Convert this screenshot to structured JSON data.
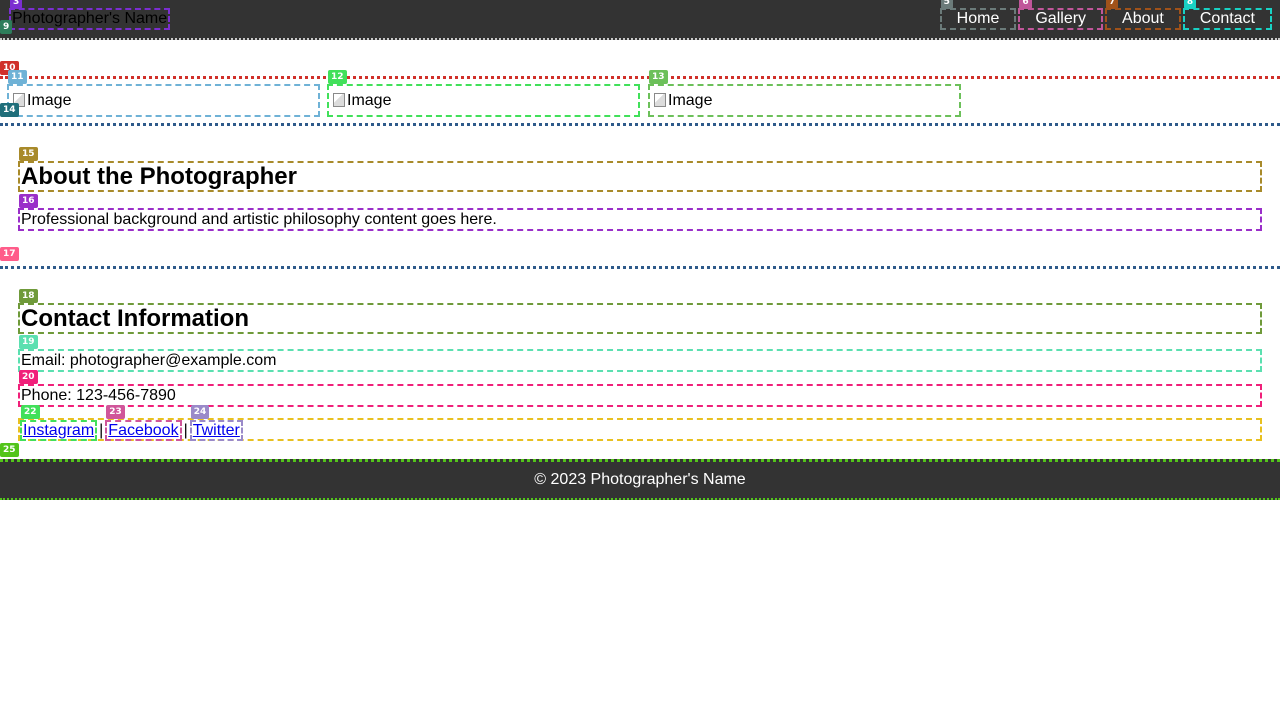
{
  "header": {
    "site_title": "Photographer's Name",
    "nav": [
      {
        "label": "Home"
      },
      {
        "label": "Gallery"
      },
      {
        "label": "About"
      },
      {
        "label": "Contact"
      }
    ]
  },
  "gallery": {
    "images": [
      {
        "alt": "Image"
      },
      {
        "alt": "Image"
      },
      {
        "alt": "Image"
      }
    ]
  },
  "about": {
    "heading": "About the Photographer",
    "text": "Professional background and artistic philosophy content goes here."
  },
  "contact": {
    "heading": "Contact Information",
    "email": "Email: photographer@example.com",
    "phone": "Phone: 123-456-7890",
    "social": [
      {
        "label": "Instagram"
      },
      {
        "label": "Facebook"
      },
      {
        "label": "Twitter"
      }
    ],
    "separator": "|"
  },
  "footer": {
    "text": "© 2023 Photographer's Name"
  },
  "annotation_labels": {
    "site_title": "3",
    "nav_home": "5",
    "nav_gallery": "6",
    "nav_about": "7",
    "nav_contact": "8",
    "header": "9",
    "gallery": "10",
    "image_1": "11",
    "image_2": "12",
    "image_3": "13",
    "gallery_end": "14",
    "about_heading": "15",
    "about_text": "16",
    "about_end": "17",
    "contact_heading": "18",
    "contact_email": "19",
    "contact_phone": "20",
    "social_instagram": "22",
    "social_facebook": "23",
    "social_twitter": "24",
    "footer": "25"
  },
  "colors": {
    "header_bg": "#333333",
    "footer_bg": "#333333",
    "link": "#0000ee",
    "nav_text": "#ffffff"
  }
}
